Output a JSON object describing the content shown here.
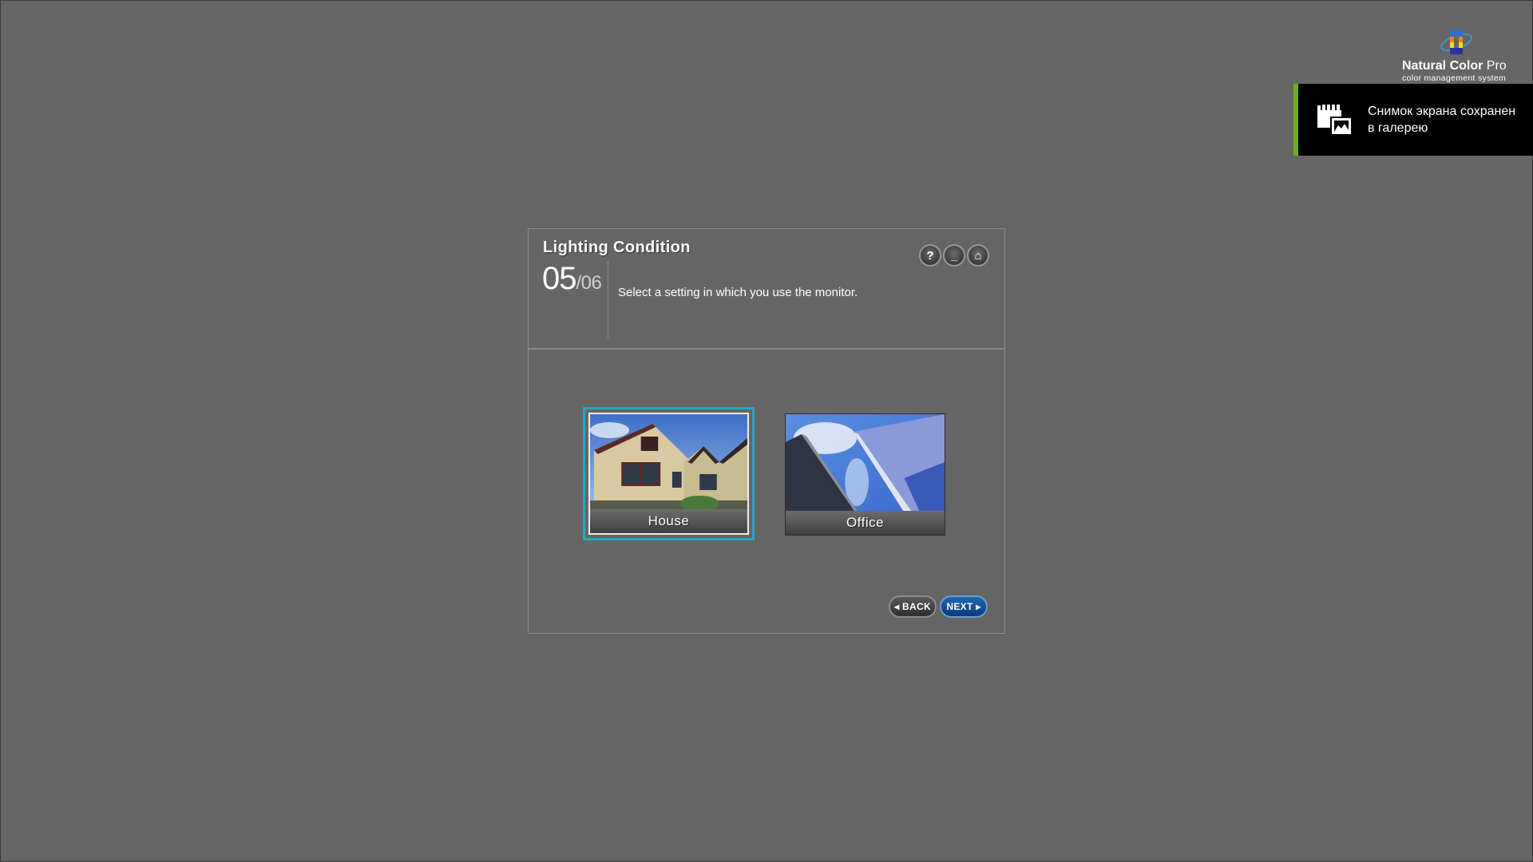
{
  "logo": {
    "name_bold": "Natural Color ",
    "name_regular": "Pro",
    "subtitle": "color management system"
  },
  "toast": {
    "icon": "screenshot-gallery-icon",
    "line1": "Снимок экрана сохранен",
    "line2": "в галерею",
    "accent_color": "#6fae1c"
  },
  "dialog": {
    "title": "Lighting Condition",
    "step_current": "05",
    "step_total": "/06",
    "instruction": "Select a setting in which you use the monitor.",
    "header_buttons": [
      {
        "icon": "help-icon",
        "glyph": "?"
      },
      {
        "icon": "minimize-icon",
        "glyph": "_"
      },
      {
        "icon": "home-icon",
        "glyph": "⌂"
      }
    ],
    "options": [
      {
        "label": "House",
        "selected": true
      },
      {
        "label": "Office",
        "selected": false
      }
    ],
    "back_label": "BACK",
    "next_label": "NEXT",
    "selection_color": "#22aac0"
  }
}
